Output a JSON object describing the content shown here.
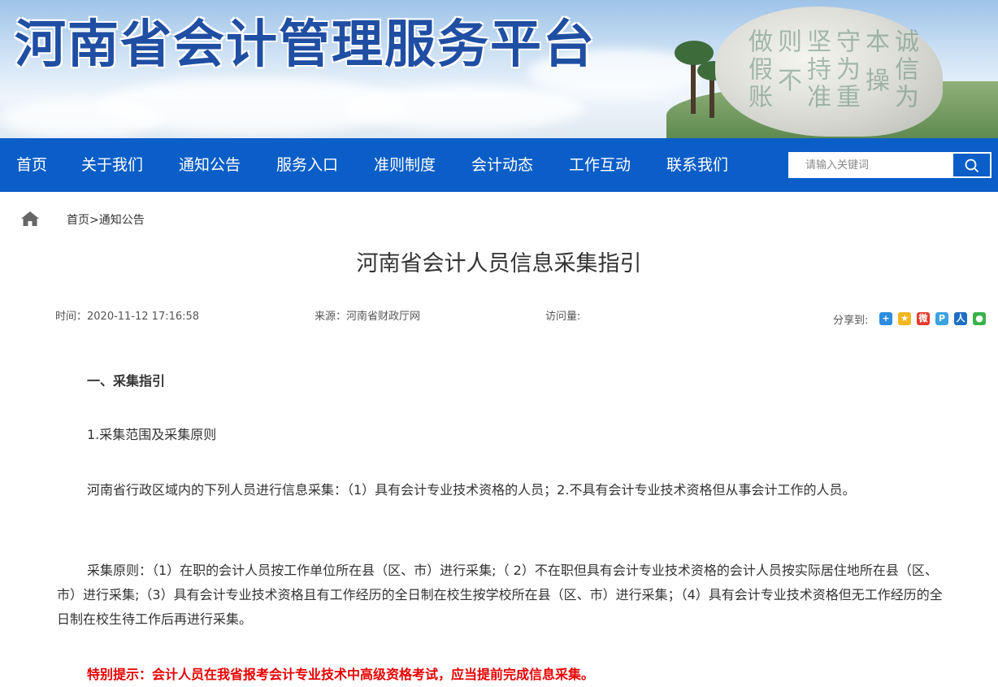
{
  "banner": {
    "title": "河南省会计管理服务平台"
  },
  "nav": {
    "items": [
      "首页",
      "关于我们",
      "通知公告",
      "服务入口",
      "准则制度",
      "会计动态",
      "工作互动",
      "联系我们"
    ],
    "search_placeholder": "请输入关键词"
  },
  "breadcrumb": {
    "home": "首页",
    "sep": ">",
    "current": "通知公告"
  },
  "article": {
    "title": "河南省会计人员信息采集指引",
    "time": "时间：2020-11-12 17:16:58",
    "source": "来源：河南省财政厅网",
    "views": "访问量:",
    "share_label": "分享到:",
    "share_icons": [
      "qzone-icon",
      "star-icon",
      "weibo-icon",
      "tencent-icon",
      "renren-icon",
      "wechat-icon"
    ],
    "heading1": "一、采集指引",
    "heading2": "1.采集范围及采集原则",
    "para1": "河南省行政区域内的下列人员进行信息采集：（1）具有会计专业技术资格的人员；2.不具有会计专业技术资格但从事会计工作的人员。",
    "para2": "采集原则：（1）在职的会计人员按工作单位所在县（区、市）进行采集;（ 2）不在职但具有会计专业技术资格的会计人员按实际居住地所在县（区、市）进行采集;（3）具有会计专业技术资格且有工作经历的全日制在校生按学校所在县（区、市）进行采集；（4）具有会计专业技术资格但无工作经历的全日制在校生待工作后再进行采集。",
    "notice": "特别提示：会计人员在我省报考会计专业技术中高级资格考试，应当提前完成信息采集。"
  },
  "colors": {
    "nav_bg": "#0b5ec8",
    "notice_red": "#e60000"
  }
}
